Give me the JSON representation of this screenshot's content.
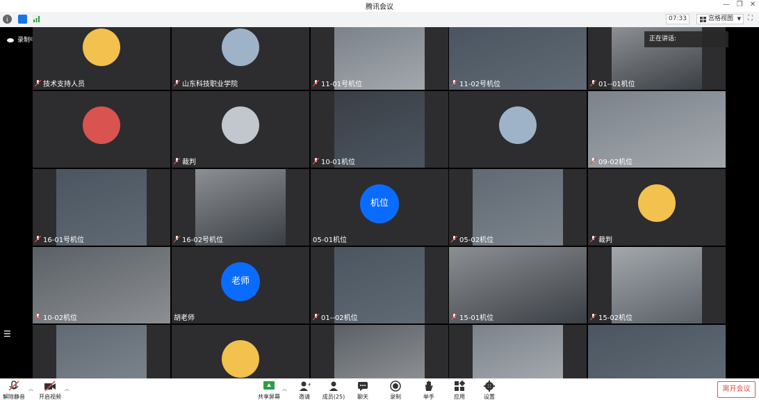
{
  "window": {
    "title": "腾讯会议"
  },
  "toolbar": {
    "timer": "07:33",
    "view_label": "宫格视图"
  },
  "stage": {
    "recording_label": "录制中",
    "speaking_label": "正在讲话:"
  },
  "tiles": [
    {
      "label": "技术支持人员",
      "kind": "avatar"
    },
    {
      "label": "山东科技职业学院",
      "kind": "avatar"
    },
    {
      "label": "11-01号机位",
      "kind": "video"
    },
    {
      "label": "11-02号机位",
      "kind": "video"
    },
    {
      "label": "01--01机位",
      "kind": "video"
    },
    {
      "label": "",
      "kind": "avatar"
    },
    {
      "label": "裁判",
      "kind": "avatar"
    },
    {
      "label": "10-01机位",
      "kind": "video"
    },
    {
      "label": "",
      "kind": "avatar"
    },
    {
      "label": "09-02机位",
      "kind": "video"
    },
    {
      "label": "16-01号机位",
      "kind": "video"
    },
    {
      "label": "16-02号机位",
      "kind": "video"
    },
    {
      "label": "05-01机位",
      "kind": "name",
      "circle": "机位"
    },
    {
      "label": "05-02机位",
      "kind": "video"
    },
    {
      "label": "裁判",
      "kind": "avatar"
    },
    {
      "label": "10-02机位",
      "kind": "video"
    },
    {
      "label": "胡老师",
      "kind": "name",
      "circle": "老师"
    },
    {
      "label": "01--02机位",
      "kind": "video"
    },
    {
      "label": "15-01机位",
      "kind": "video"
    },
    {
      "label": "15-02机位",
      "kind": "video"
    },
    {
      "label": "",
      "kind": "video"
    },
    {
      "label": "",
      "kind": "avatar"
    },
    {
      "label": "",
      "kind": "video"
    },
    {
      "label": "",
      "kind": "video"
    },
    {
      "label": "",
      "kind": "video"
    }
  ],
  "controls": {
    "unmute": "解除静音",
    "start_video": "开启视频",
    "share_screen": "共享屏幕",
    "invite": "邀请",
    "members": "成员(25)",
    "chat": "聊天",
    "record": "录制",
    "raise_hand": "举手",
    "apps": "应用",
    "settings": "设置",
    "leave": "离开会议"
  },
  "colors": {
    "accent": "#0a6cff",
    "leave": "#e64b4b",
    "tile_bg": "#2d2d30"
  }
}
